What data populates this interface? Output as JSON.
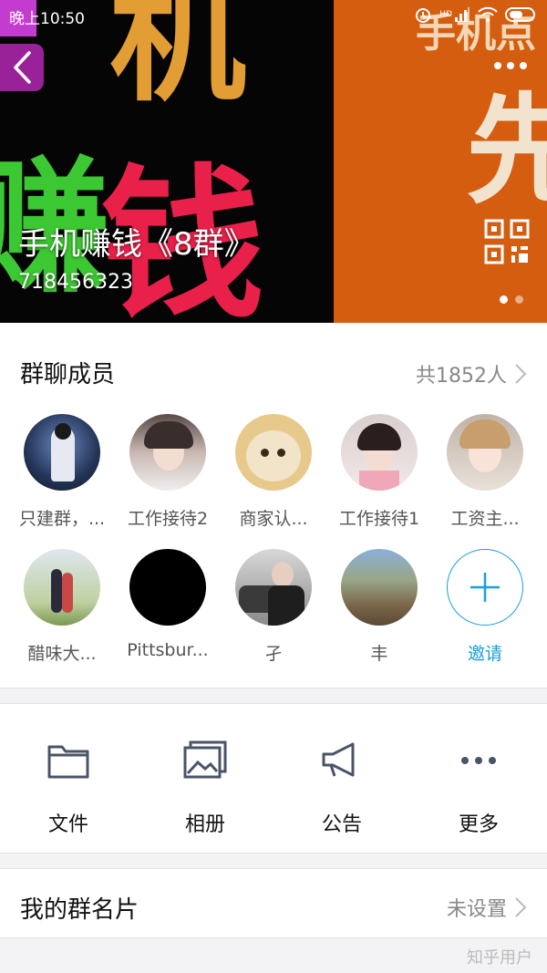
{
  "status_bar": {
    "time": "晚上10:50",
    "hd_badge": "HD"
  },
  "hero": {
    "group_name": "手机赚钱《8群》",
    "group_id": "718456323",
    "banner_overlay_text": "手机点",
    "page_count": 2,
    "active_page": 0
  },
  "members": {
    "title": "群聊成员",
    "count_label": "共1852人",
    "items": [
      {
        "name": "只建群，...",
        "avatar": "dark-portrait"
      },
      {
        "name": "工作接待2",
        "avatar": "girl-portrait"
      },
      {
        "name": "商家认...",
        "avatar": "cat"
      },
      {
        "name": "工作接待1",
        "avatar": "girl-portrait-2"
      },
      {
        "name": "工资主...",
        "avatar": "girl-portrait-3"
      },
      {
        "name": "醋味大...",
        "avatar": "couple-outdoor"
      },
      {
        "name": "Pittsbur...",
        "avatar": "black-circle"
      },
      {
        "name": "孑",
        "avatar": "man-car"
      },
      {
        "name": "丰",
        "avatar": "town-landscape"
      }
    ],
    "invite_label": "邀请"
  },
  "actions": [
    {
      "label": "文件",
      "icon": "folder-icon"
    },
    {
      "label": "相册",
      "icon": "photo-album-icon"
    },
    {
      "label": "公告",
      "icon": "megaphone-icon"
    },
    {
      "label": "更多",
      "icon": "more-icon"
    }
  ],
  "group_card": {
    "title": "我的群名片",
    "value": "未设置"
  },
  "watermark": "知乎用户",
  "colors": {
    "accent": "#1aa0d8",
    "banner_orange": "#d45d10",
    "icon_gray": "#4a5468"
  }
}
